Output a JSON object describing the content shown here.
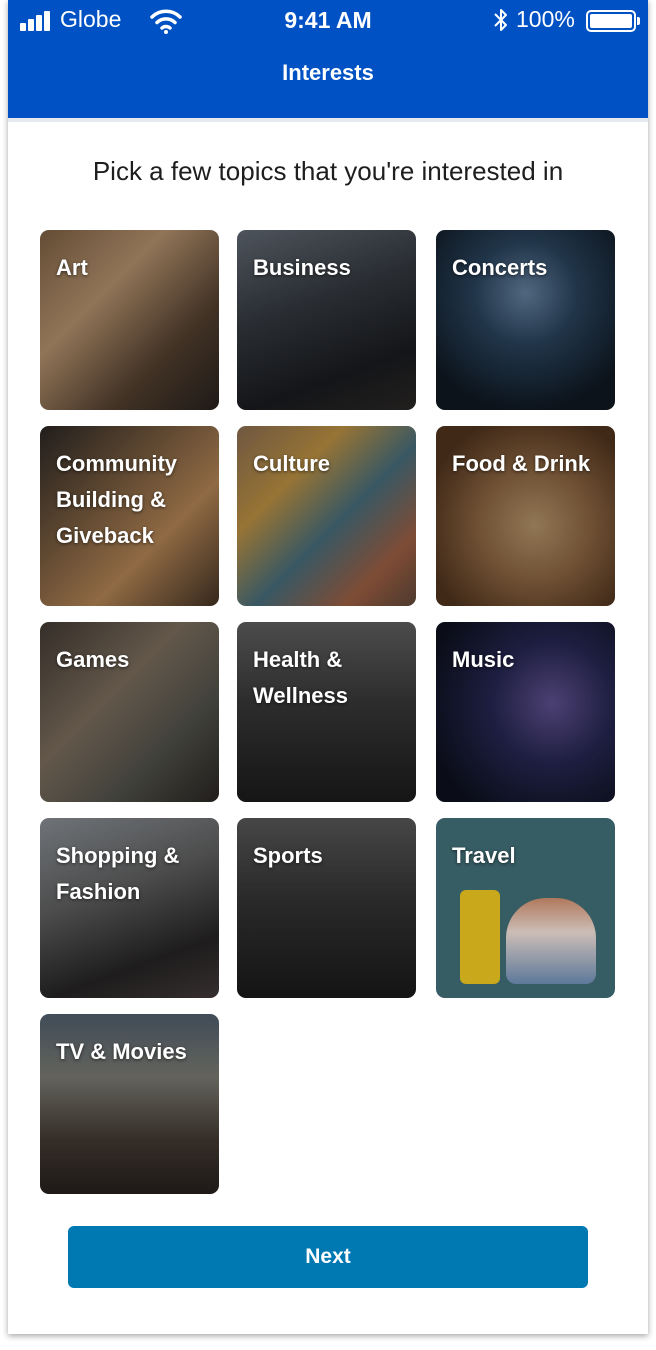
{
  "status_bar": {
    "carrier": "Globe",
    "time": "9:41 AM",
    "battery_percent": "100%",
    "icons": [
      "signal-icon",
      "wifi-icon",
      "bluetooth-icon",
      "battery-icon"
    ]
  },
  "header": {
    "title": "Interests",
    "background_color": "#0052c4"
  },
  "prompt": "Pick a few topics that you're interested in",
  "topics": [
    {
      "label": "Art"
    },
    {
      "label": "Business"
    },
    {
      "label": "Concerts"
    },
    {
      "label": "Community Building & Giveback"
    },
    {
      "label": "Culture"
    },
    {
      "label": "Food & Drink"
    },
    {
      "label": "Games"
    },
    {
      "label": "Health & Wellness"
    },
    {
      "label": "Music"
    },
    {
      "label": "Shopping & Fashion"
    },
    {
      "label": "Sports"
    },
    {
      "label": "Travel"
    },
    {
      "label": "TV & Movies"
    }
  ],
  "next_button": {
    "label": "Next",
    "color": "#0079b3"
  }
}
